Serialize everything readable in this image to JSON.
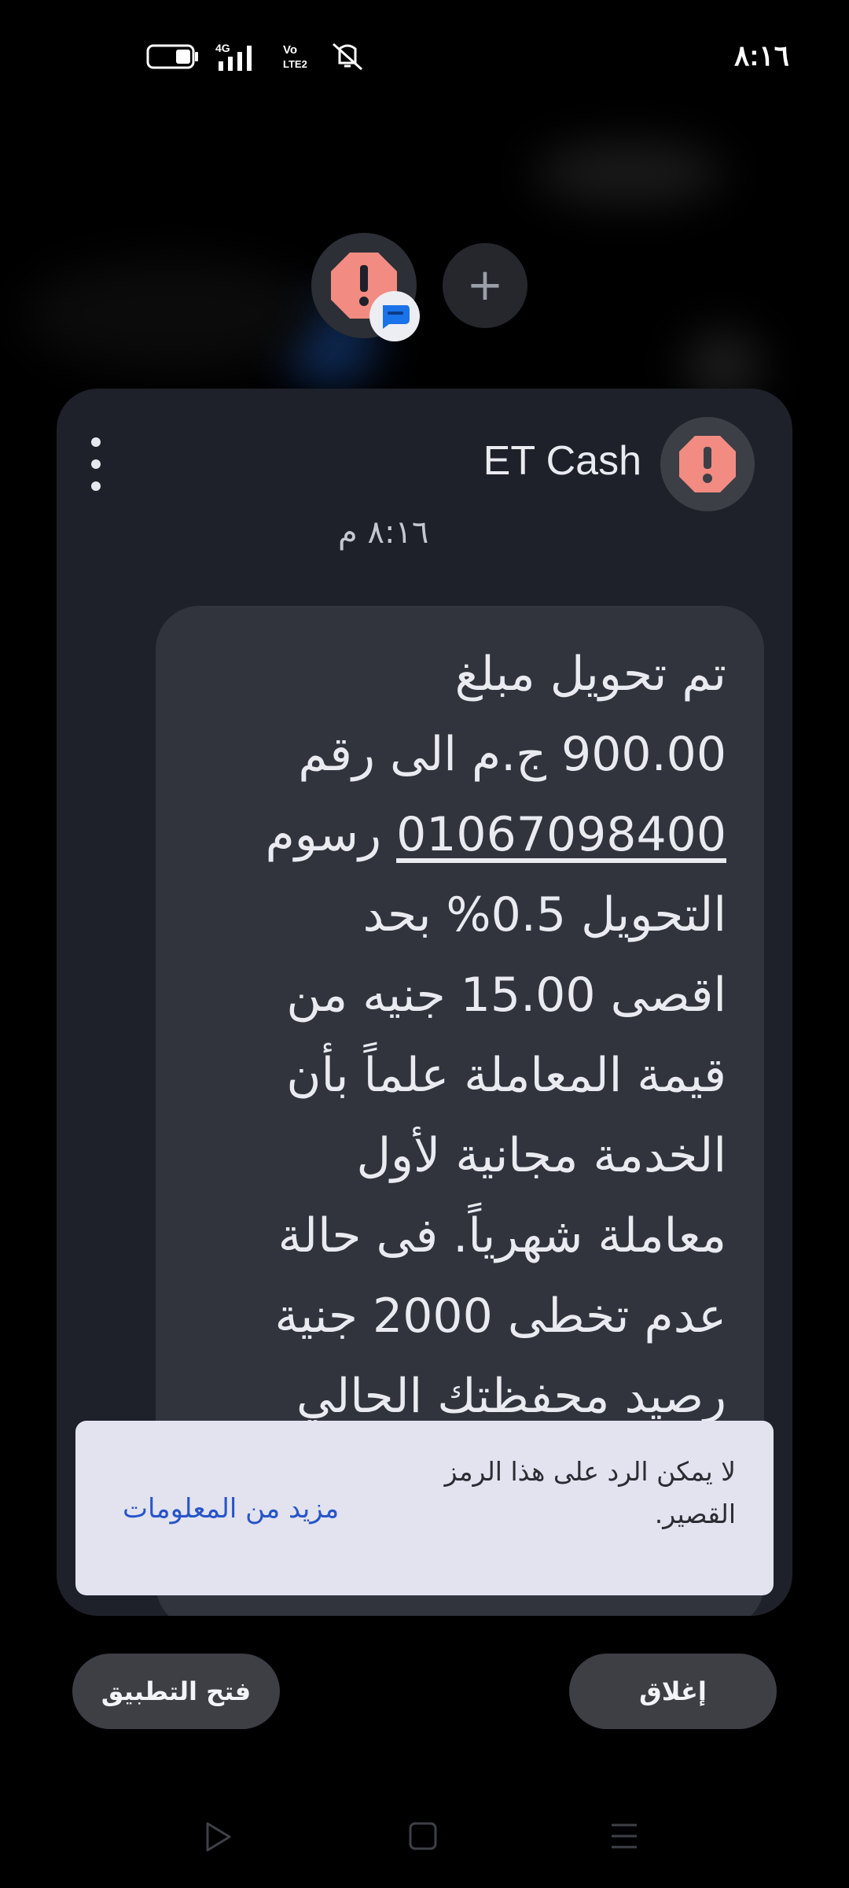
{
  "status_bar": {
    "time": "٨:١٦",
    "network": "4G",
    "volte": "Vo LTE 2"
  },
  "bubble": {
    "add_label": "+"
  },
  "conversation": {
    "contact_name": "ET Cash",
    "timestamp": "٨:١٦ م",
    "message_lines": [
      "تم تحويل مبلغ",
      "900.00 ج.م الى رقم",
      "رسوم",
      "التحويل 0.5% بحد",
      "اقصى 15.00 جنيه من",
      "قيمة المعاملة علماً بأن",
      "الخدمة مجانية لأول",
      "معاملة شهرياً. فى حالة",
      "عدم تخطى 2000 جنية",
      "رصيد محفظتك الحالي"
    ],
    "phone_number": "01067098400"
  },
  "info_banner": {
    "text": "لا يمكن الرد على هذا الرمز القصير.",
    "link": "مزيد من المعلومات"
  },
  "actions": {
    "close": "إغلاق",
    "open_app": "فتح التطبيق"
  },
  "colors": {
    "alert_icon": "#f28b82",
    "card_bg": "#1e2129",
    "message_bg": "#31343d",
    "banner_bg": "#e2e3ee",
    "link": "#2855c9",
    "messages_badge": "#1a73e8"
  }
}
